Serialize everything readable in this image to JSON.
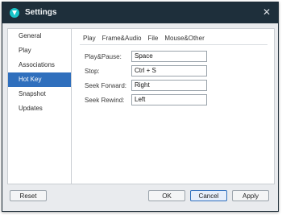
{
  "window": {
    "title": "Settings"
  },
  "sidebar": {
    "items": [
      {
        "label": "General"
      },
      {
        "label": "Play"
      },
      {
        "label": "Associations"
      },
      {
        "label": "Hot Key"
      },
      {
        "label": "Snapshot"
      },
      {
        "label": "Updates"
      }
    ],
    "active_index": 3
  },
  "content": {
    "tabs": [
      {
        "label": "Play"
      },
      {
        "label": "Frame&Audio"
      },
      {
        "label": "File"
      },
      {
        "label": "Mouse&Other"
      }
    ],
    "active_tab": 0,
    "fields": [
      {
        "label": "Play&Pause:",
        "value": "Space"
      },
      {
        "label": "Stop:",
        "value": "Ctrl + S"
      },
      {
        "label": "Seek Forward:",
        "value": "Right"
      },
      {
        "label": "Seek Rewind:",
        "value": "Left"
      }
    ]
  },
  "footer": {
    "reset_label": "Reset",
    "ok_label": "OK",
    "cancel_label": "Cancel",
    "apply_label": "Apply"
  },
  "colors": {
    "titlebar": "#1e2f3b",
    "accent": "#2f6fbd",
    "background": "#e9ebee"
  },
  "icons": {
    "app": "app-logo-icon",
    "close": "close-icon"
  }
}
